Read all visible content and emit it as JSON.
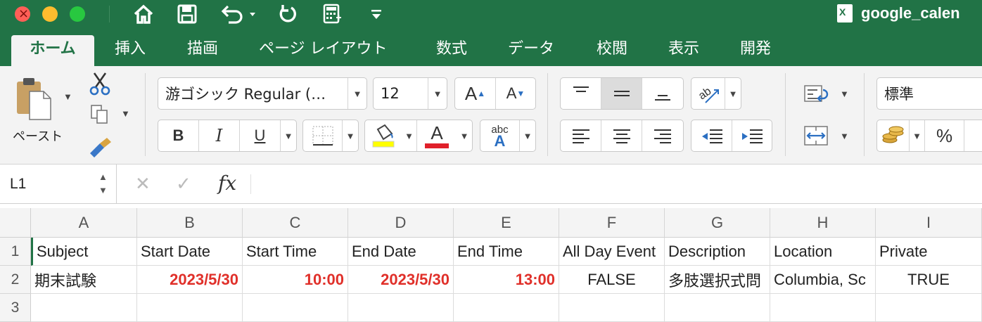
{
  "window": {
    "title": "google_calen",
    "colors": {
      "accent": "#217346",
      "error": "#e0302a"
    }
  },
  "quick_access": [
    "home-icon",
    "save-icon",
    "undo-icon",
    "redo-icon",
    "calculator-icon",
    "customize-icon"
  ],
  "tabs": [
    {
      "label": "ホーム",
      "active": true
    },
    {
      "label": "挿入"
    },
    {
      "label": "描画"
    },
    {
      "label": "ページ レイアウト"
    },
    {
      "label": "数式"
    },
    {
      "label": "データ"
    },
    {
      "label": "校閲"
    },
    {
      "label": "表示"
    },
    {
      "label": "開発"
    }
  ],
  "ribbon": {
    "paste_label": "ペースト",
    "font_name": "游ゴシック Regular (…",
    "font_size": "12",
    "bold": "B",
    "italic": "I",
    "underline": "U",
    "font_color_glyph": "A",
    "abc_glyph": "abc",
    "number_format": "標準",
    "percent": "%"
  },
  "formula_bar": {
    "name_box": "L1",
    "fx": "fx",
    "formula": ""
  },
  "sheet": {
    "columns": [
      "A",
      "B",
      "C",
      "D",
      "E",
      "F",
      "G",
      "H",
      "I"
    ],
    "rows": [
      "1",
      "2",
      "3"
    ],
    "row1": [
      "Subject",
      "Start Date",
      "Start Time",
      "End Date",
      "End Time",
      "All Day Event",
      "Description",
      "Location",
      "Private"
    ],
    "row2": [
      "期末試験",
      "2023/5/30",
      "10:00",
      "2023/5/30",
      "13:00",
      "FALSE",
      "多肢選択式問",
      "Columbia, Sc",
      "TRUE"
    ],
    "row3": [
      "",
      "",
      "",
      "",
      "",
      "",
      "",
      "",
      ""
    ]
  }
}
